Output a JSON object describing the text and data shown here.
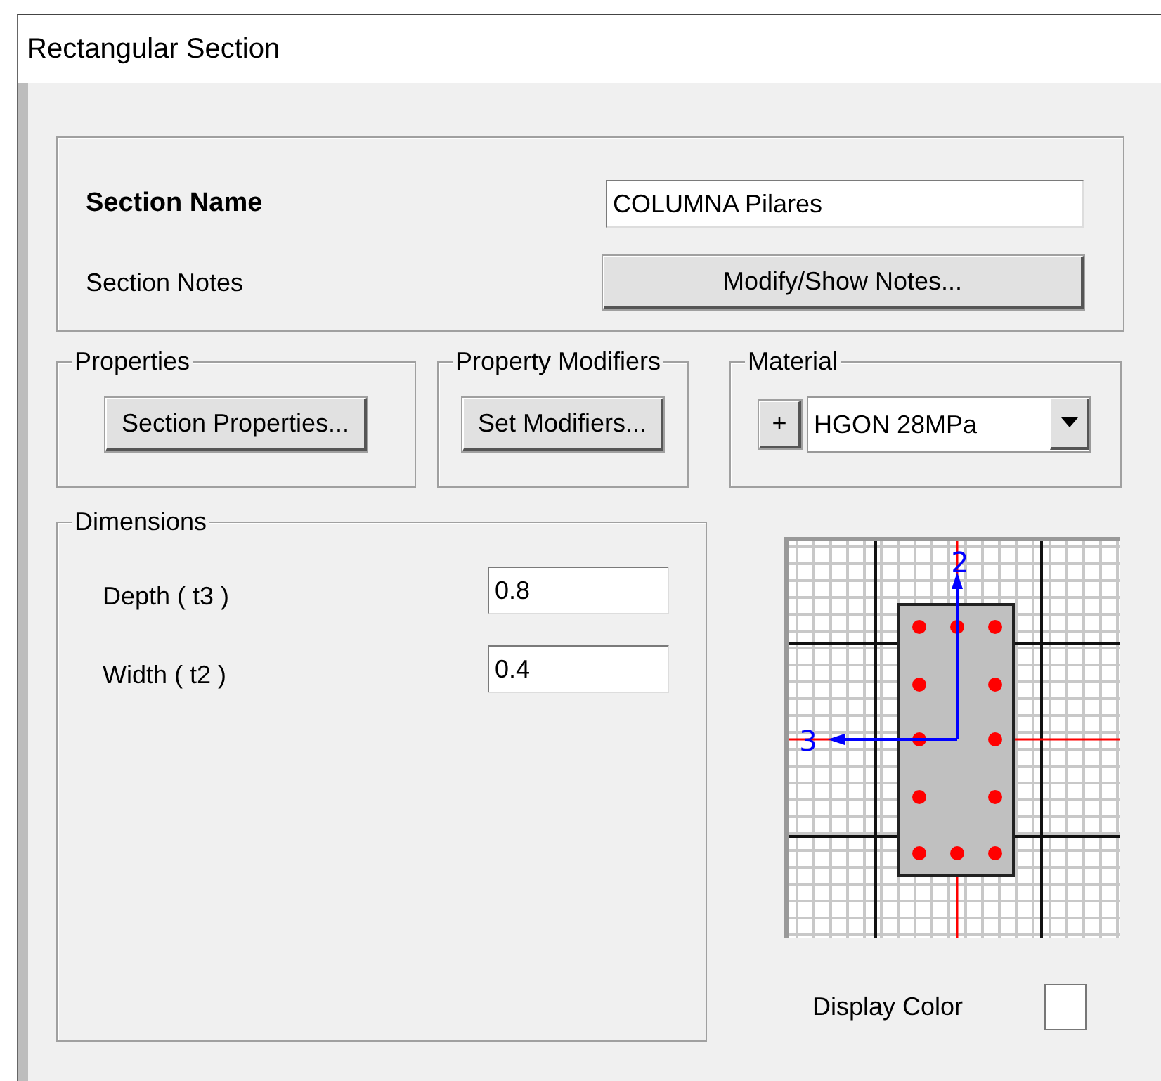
{
  "window": {
    "title": "Rectangular Section"
  },
  "section_name": {
    "label": "Section Name",
    "value": "COLUMNA Pilares"
  },
  "section_notes": {
    "label": "Section Notes",
    "button": "Modify/Show Notes..."
  },
  "properties": {
    "legend": "Properties",
    "button": "Section Properties..."
  },
  "property_modifiers": {
    "legend": "Property Modifiers",
    "button": "Set Modifiers..."
  },
  "material": {
    "legend": "Material",
    "add_button": "+",
    "value": "HGON 28MPa"
  },
  "dimensions": {
    "legend": "Dimensions",
    "fields": [
      {
        "label": "Depth  ( t3 )",
        "value": "0.8"
      },
      {
        "label": "Width  ( t2 )",
        "value": "0.4"
      }
    ]
  },
  "section_preview": {
    "axis_2_label": "2",
    "axis_3_label": "3"
  },
  "display_color": {
    "label": "Display Color",
    "color": "#ffffff"
  }
}
